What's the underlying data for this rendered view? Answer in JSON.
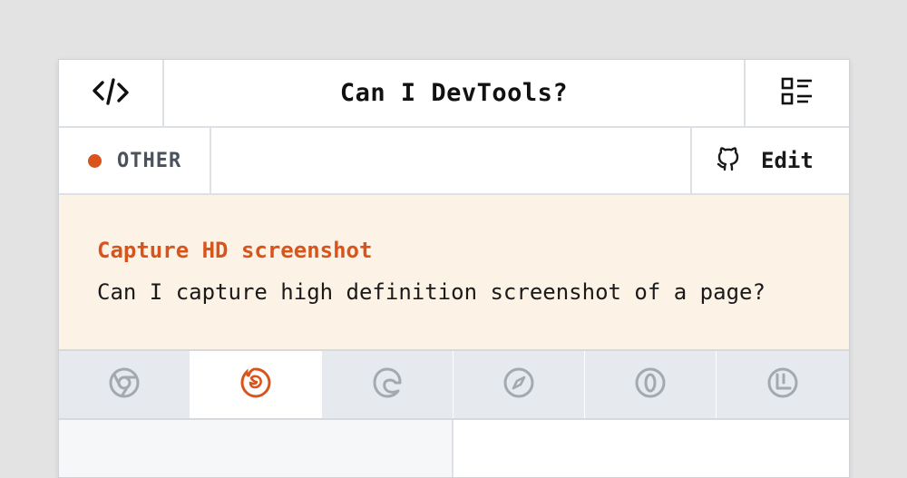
{
  "header": {
    "title": "Can I DevTools?",
    "left_icon": "code-icon",
    "right_icon": "list-icon"
  },
  "category": {
    "label": "OTHER",
    "dot_color": "#d9541a"
  },
  "edit": {
    "label": "Edit",
    "icon": "github-icon"
  },
  "feature": {
    "title": "Capture HD screenshot",
    "description": "Can I capture high definition screenshot of a page?",
    "background": "#fdf2e6",
    "accent": "#d9541a"
  },
  "browsers": {
    "active": "firefox",
    "items": [
      {
        "name": "chrome",
        "icon": "chrome-icon"
      },
      {
        "name": "firefox",
        "icon": "firefox-icon"
      },
      {
        "name": "edge",
        "icon": "edge-icon"
      },
      {
        "name": "safari",
        "icon": "safari-icon"
      },
      {
        "name": "opera",
        "icon": "opera-icon"
      },
      {
        "name": "vivaldi",
        "icon": "vivaldi-icon"
      }
    ]
  }
}
